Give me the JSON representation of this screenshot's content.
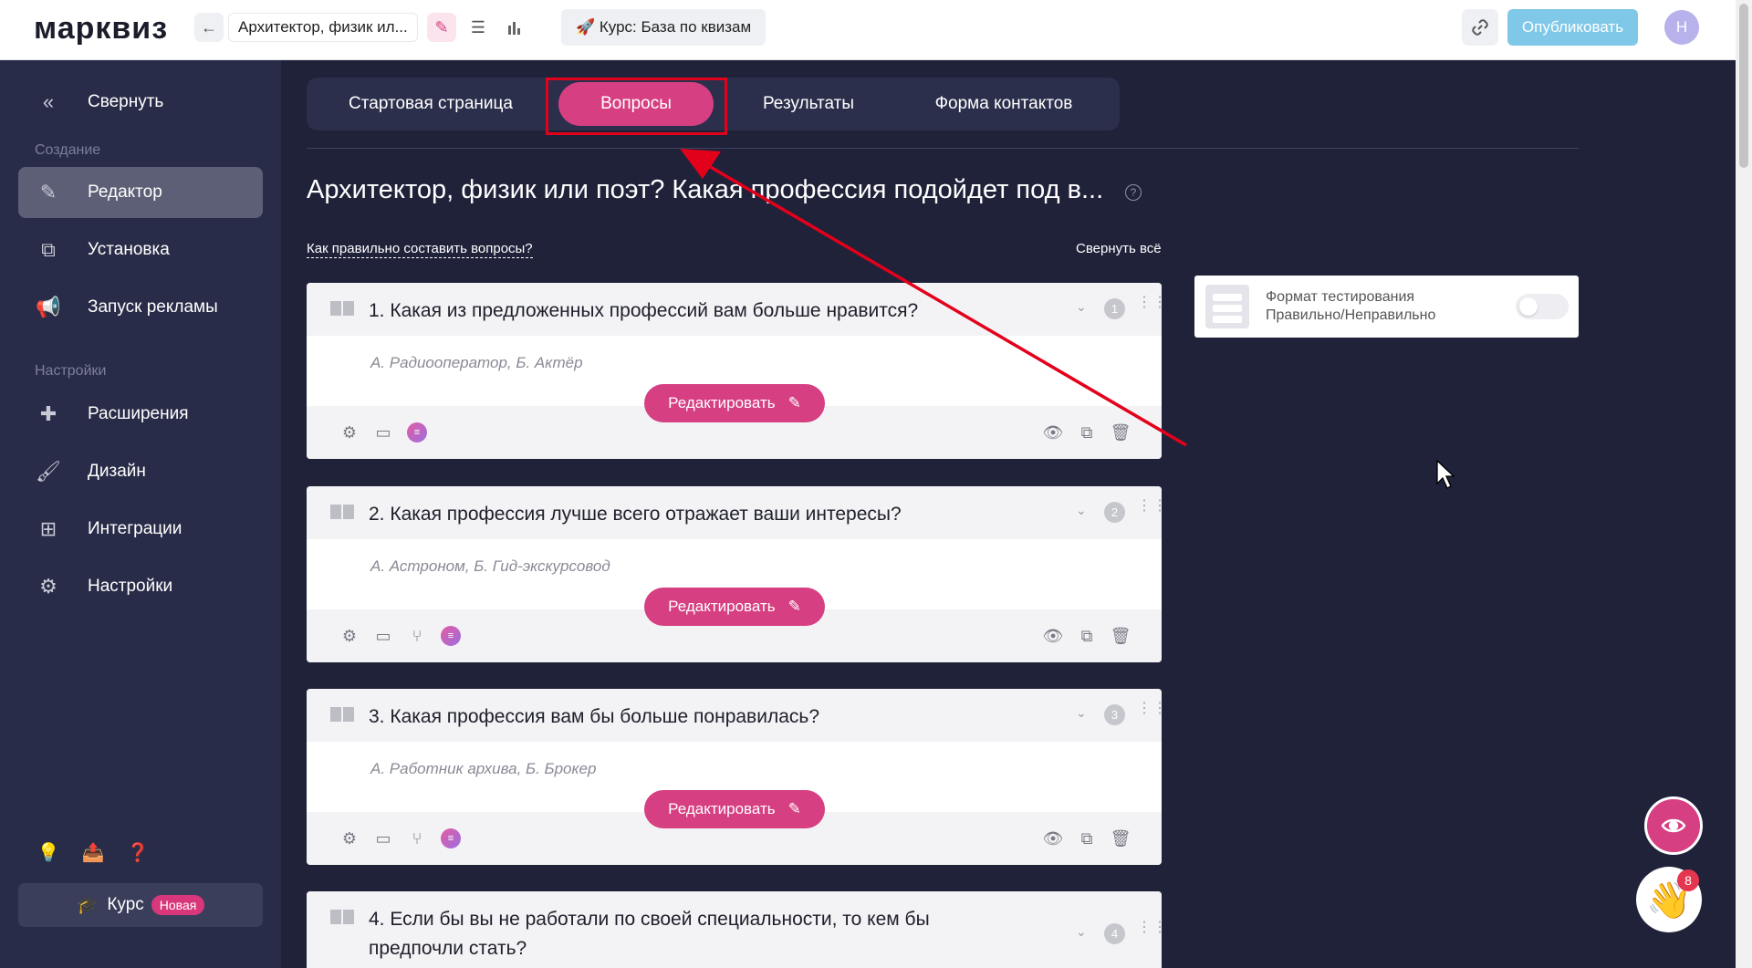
{
  "header": {
    "logo": "марквиз",
    "quiz_title": "Архитектор, физик ил...",
    "course_label": "🚀 Курс: База по квизам",
    "publish_label": "Опубликовать",
    "avatar_letter": "Н"
  },
  "sidebar": {
    "collapse_label": "Свернуть",
    "section_create": "Создание",
    "section_settings": "Настройки",
    "items": [
      {
        "label": "Редактор",
        "icon": "pencil-icon",
        "active": true
      },
      {
        "label": "Установка",
        "icon": "install-icon"
      },
      {
        "label": "Запуск рекламы",
        "icon": "megaphone-icon"
      },
      {
        "label": "Расширения",
        "icon": "puzzle-icon"
      },
      {
        "label": "Дизайн",
        "icon": "brush-icon"
      },
      {
        "label": "Интеграции",
        "icon": "integrations-icon"
      },
      {
        "label": "Настройки",
        "icon": "gear-icon"
      }
    ],
    "course_label": "Курс",
    "course_badge": "Новая"
  },
  "tabs": [
    {
      "label": "Стартовая страница"
    },
    {
      "label": "Вопросы",
      "active": true
    },
    {
      "label": "Результаты"
    },
    {
      "label": "Форма контактов"
    }
  ],
  "main": {
    "title": "Архитектор, физик или поэт? Какая профессия подойдет под в...",
    "howto_link": "Как правильно составить вопросы?",
    "collapse_all": "Свернуть всё",
    "edit_label": "Редактировать"
  },
  "questions": [
    {
      "number": "1",
      "title": "1. Какая из предложенных профессий вам больше нравится?",
      "answers": "А. Радиооператор, Б. Актёр"
    },
    {
      "number": "2",
      "title": "2. Какая профессия лучше всего отражает ваши интересы?",
      "answers": "А. Астроном, Б. Гид-экскурсовод"
    },
    {
      "number": "3",
      "title": "3. Какая профессия вам бы больше понравилась?",
      "answers": "А. Работник архива, Б. Брокер"
    },
    {
      "number": "4",
      "title_line1": "4. Если бы вы не работали по своей специальности, то кем бы",
      "title_line2": "предпочли стать?"
    }
  ],
  "format_card": {
    "line1": "Формат тестирования",
    "line2": "Правильно/Неправильно"
  },
  "fab": {
    "notification_count": "8"
  },
  "colors": {
    "accent": "#d63f82",
    "sidebar_bg": "#292c48",
    "main_bg": "#20223a",
    "publish": "#7fc8e8",
    "annotation": "#e3001b"
  }
}
